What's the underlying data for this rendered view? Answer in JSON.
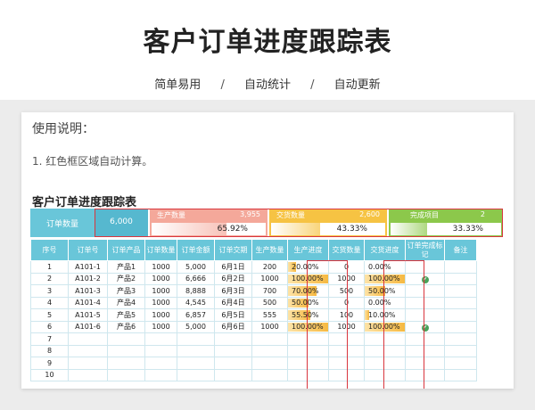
{
  "header": {
    "title": "客户订单进度跟踪表",
    "tags": [
      "简单易用",
      "自动统计",
      "自动更新"
    ],
    "separator": "/"
  },
  "usage": {
    "title": "使用说明：",
    "text": "1. 红色框区域自动计算。"
  },
  "table_title": "客户订单进度跟踪表",
  "summary": {
    "order_qty": {
      "label": "订单数量",
      "value": "6,000"
    },
    "production": {
      "label": "生产数量",
      "value": "3,955",
      "percent": "65.92%",
      "fraction": 0.6592,
      "color": "#f4a89a"
    },
    "delivery": {
      "label": "交货数量",
      "value": "2,600",
      "percent": "43.33%",
      "fraction": 0.4333,
      "color": "#f6c343"
    },
    "completed": {
      "label": "完成项目",
      "value": "2",
      "percent": "33.33%",
      "fraction": 0.3333,
      "color": "#8cc84b"
    },
    "colors": {
      "order_label": "#69c6d9",
      "order_value": "#56b8cf"
    }
  },
  "columns": [
    "序号",
    "订单号",
    "订单产品",
    "订单数量",
    "订单金额",
    "订单交期",
    "生产数量",
    "生产进度",
    "交货数量",
    "交货进度",
    "订单完成标记",
    "备注"
  ],
  "rows": [
    {
      "no": "1",
      "order": "A101-1",
      "product": "产品1",
      "qty": "1000",
      "amount": "5,000",
      "date": "6月1日",
      "prod": "200",
      "prod_pct": "20.00%",
      "prod_frac": 0.2,
      "deliv": "0",
      "deliv_pct": "0.00%",
      "deliv_frac": 0.0,
      "done": false,
      "note": ""
    },
    {
      "no": "2",
      "order": "A101-2",
      "product": "产品2",
      "qty": "1000",
      "amount": "6,666",
      "date": "6月2日",
      "prod": "1000",
      "prod_pct": "100.00%",
      "prod_frac": 1.0,
      "deliv": "1000",
      "deliv_pct": "100.00%",
      "deliv_frac": 1.0,
      "done": true,
      "note": ""
    },
    {
      "no": "3",
      "order": "A101-3",
      "product": "产品3",
      "qty": "1000",
      "amount": "8,888",
      "date": "6月3日",
      "prod": "700",
      "prod_pct": "70.00%",
      "prod_frac": 0.7,
      "deliv": "500",
      "deliv_pct": "50.00%",
      "deliv_frac": 0.5,
      "done": false,
      "note": ""
    },
    {
      "no": "4",
      "order": "A101-4",
      "product": "产品4",
      "qty": "1000",
      "amount": "4,545",
      "date": "6月4日",
      "prod": "500",
      "prod_pct": "50.00%",
      "prod_frac": 0.5,
      "deliv": "0",
      "deliv_pct": "0.00%",
      "deliv_frac": 0.0,
      "done": false,
      "note": ""
    },
    {
      "no": "5",
      "order": "A101-5",
      "product": "产品5",
      "qty": "1000",
      "amount": "6,857",
      "date": "6月5日",
      "prod": "555",
      "prod_pct": "55.50%",
      "prod_frac": 0.555,
      "deliv": "100",
      "deliv_pct": "10.00%",
      "deliv_frac": 0.1,
      "done": false,
      "note": ""
    },
    {
      "no": "6",
      "order": "A101-6",
      "product": "产品6",
      "qty": "1000",
      "amount": "5,000",
      "date": "6月6日",
      "prod": "1000",
      "prod_pct": "100.00%",
      "prod_frac": 1.0,
      "deliv": "1000",
      "deliv_pct": "100.00%",
      "deliv_frac": 1.0,
      "done": true,
      "note": ""
    },
    {
      "no": "7"
    },
    {
      "no": "8"
    },
    {
      "no": "9"
    },
    {
      "no": "10"
    }
  ],
  "check_icon": "✔"
}
